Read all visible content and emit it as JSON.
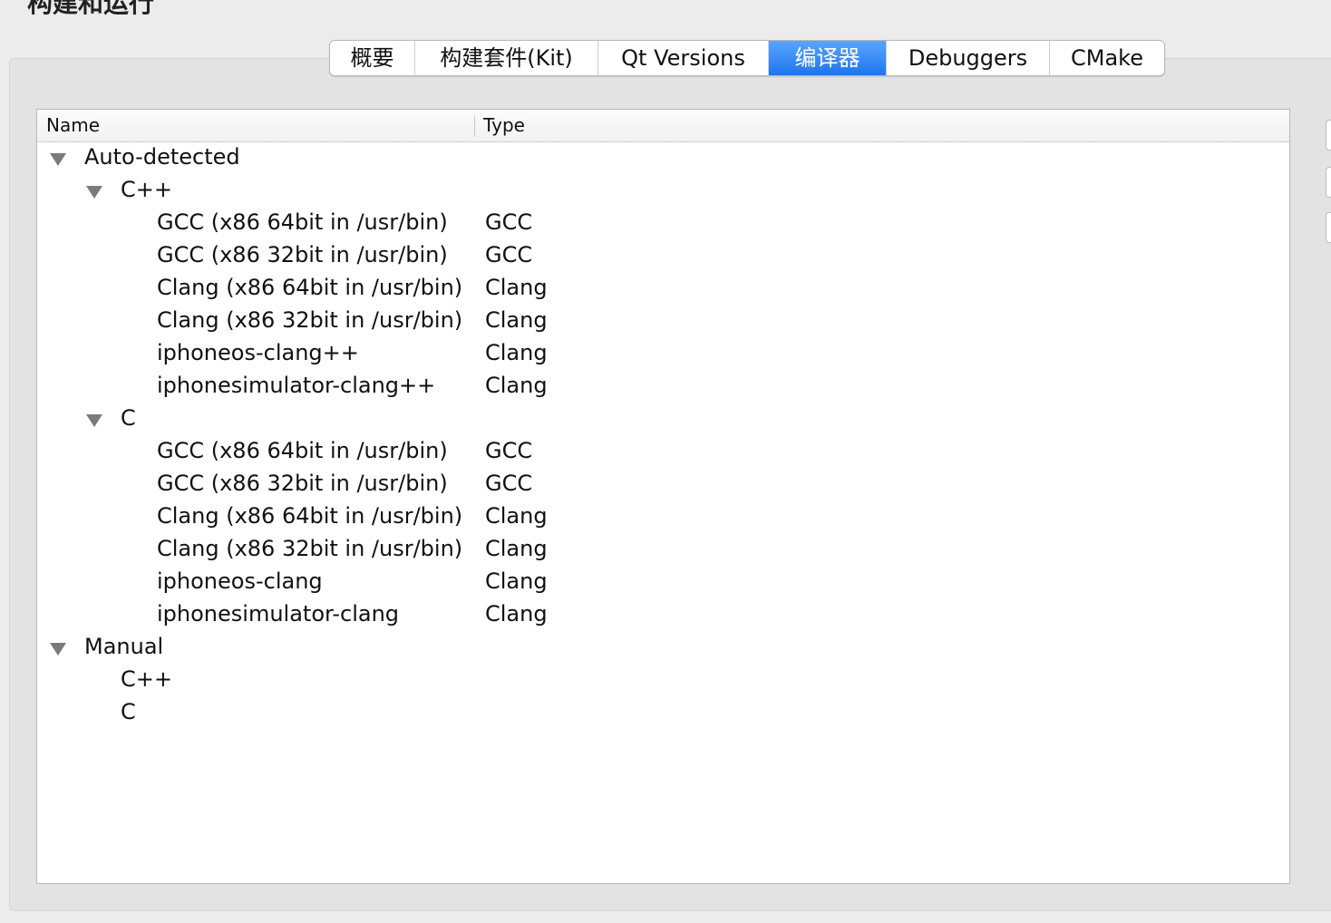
{
  "window": {
    "title": "构建和运行"
  },
  "tabs": [
    {
      "label": "概要",
      "active": false
    },
    {
      "label": "构建套件(Kit)",
      "active": false
    },
    {
      "label": "Qt Versions",
      "active": false
    },
    {
      "label": "编译器",
      "active": true
    },
    {
      "label": "Debuggers",
      "active": false
    },
    {
      "label": "CMake",
      "active": false
    }
  ],
  "tree": {
    "columns": {
      "name": "Name",
      "type": "Type"
    },
    "rows": [
      {
        "name": "Auto-detected",
        "type": "",
        "expandable": true
      },
      {
        "name": "C++",
        "type": "",
        "expandable": true
      },
      {
        "name": "GCC (x86 64bit in /usr/bin)",
        "type": "GCC",
        "expandable": false
      },
      {
        "name": "GCC (x86 32bit in /usr/bin)",
        "type": "GCC",
        "expandable": false
      },
      {
        "name": "Clang (x86 64bit in /usr/bin)",
        "type": "Clang",
        "expandable": false
      },
      {
        "name": "Clang (x86 32bit in /usr/bin)",
        "type": "Clang",
        "expandable": false
      },
      {
        "name": "iphoneos-clang++",
        "type": "Clang",
        "expandable": false
      },
      {
        "name": "iphonesimulator-clang++",
        "type": "Clang",
        "expandable": false
      },
      {
        "name": "C",
        "type": "",
        "expandable": true
      },
      {
        "name": "GCC (x86 64bit in /usr/bin)",
        "type": "GCC",
        "expandable": false
      },
      {
        "name": "GCC (x86 32bit in /usr/bin)",
        "type": "GCC",
        "expandable": false
      },
      {
        "name": "Clang (x86 64bit in /usr/bin)",
        "type": "Clang",
        "expandable": false
      },
      {
        "name": "Clang (x86 32bit in /usr/bin)",
        "type": "Clang",
        "expandable": false
      },
      {
        "name": "iphoneos-clang",
        "type": "Clang",
        "expandable": false
      },
      {
        "name": "iphonesimulator-clang",
        "type": "Clang",
        "expandable": false
      },
      {
        "name": "Manual",
        "type": "",
        "expandable": true
      },
      {
        "name": "C++",
        "type": "",
        "expandable": false
      },
      {
        "name": "C",
        "type": "",
        "expandable": false
      }
    ]
  },
  "colors": {
    "accent": "#1e74ef",
    "tree_bg": "#ffffff",
    "panel_bg": "#e3e3e3"
  }
}
